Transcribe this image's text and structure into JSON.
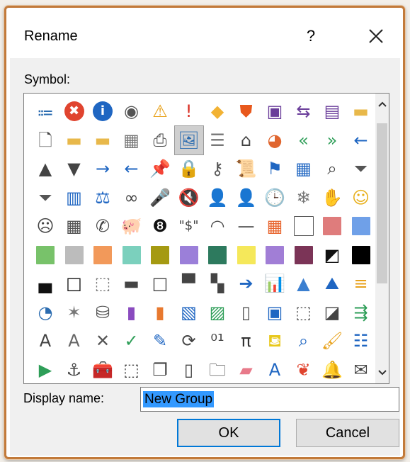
{
  "dialog": {
    "title": "Rename",
    "help_label": "?",
    "symbol_label": "Symbol:",
    "display_name_label": "Display name:",
    "display_name_value": "New Group",
    "ok_label": "OK",
    "cancel_label": "Cancel"
  },
  "symbols": [
    [
      {
        "icon": "org-chart-icon",
        "glyph": "⩴",
        "color": "#2b6cb0"
      },
      {
        "icon": "error-icon",
        "glyph": "✖",
        "color": "#e0442f"
      },
      {
        "icon": "info-icon",
        "glyph": "i",
        "color": "#1f66c2"
      },
      {
        "icon": "stop-record-icon",
        "glyph": "◉",
        "color": "#555555"
      },
      {
        "icon": "warning-triangle-icon",
        "glyph": "⚠",
        "color": "#e8a21c"
      },
      {
        "icon": "exclamation-icon",
        "glyph": "!",
        "color": "#d93025"
      },
      {
        "icon": "warning-diamond-icon",
        "glyph": "◆",
        "color": "#f2b233"
      },
      {
        "icon": "shield-icon",
        "glyph": "⛊",
        "color": "#e8581c"
      },
      {
        "icon": "save-icon",
        "glyph": "▣",
        "color": "#6a3d9a"
      },
      {
        "icon": "secure-share-icon",
        "glyph": "⇆",
        "color": "#6a3d9a"
      },
      {
        "icon": "save-all-icon",
        "glyph": "▤",
        "color": "#6a3d9a"
      },
      {
        "icon": "folder-icon",
        "glyph": "▬",
        "color": "#e8b84a"
      }
    ],
    [
      {
        "icon": "document-icon",
        "glyph": "🗋",
        "color": "#444444"
      },
      {
        "icon": "folder-green-icon",
        "glyph": "▬",
        "color": "#e8b84a"
      },
      {
        "icon": "folders-icon",
        "glyph": "▬",
        "color": "#e8b84a"
      },
      {
        "icon": "table-view-icon",
        "glyph": "▦",
        "color": "#777777"
      },
      {
        "icon": "printer-icon",
        "glyph": "⎙",
        "color": "#444444"
      },
      {
        "icon": "picture-icon",
        "glyph": "🖼",
        "color": "#2b6cb0"
      },
      {
        "icon": "document-list-icon",
        "glyph": "☰",
        "color": "#777777"
      },
      {
        "icon": "home-icon",
        "glyph": "⌂",
        "color": "#444444"
      },
      {
        "icon": "pie-chart-icon",
        "glyph": "◕",
        "color": "#e0662f"
      },
      {
        "icon": "double-left-arrow-icon",
        "glyph": "«",
        "color": "#2e9e58"
      },
      {
        "icon": "double-right-arrow-icon",
        "glyph": "»",
        "color": "#2e9e58"
      },
      {
        "icon": "left-arrow-icon",
        "glyph": "←",
        "color": "#1f66c2"
      }
    ],
    [
      {
        "icon": "triangle-up-icon",
        "glyph": "▲",
        "color": "#444444"
      },
      {
        "icon": "triangle-down-icon",
        "glyph": "▼",
        "color": "#444444"
      },
      {
        "icon": "right-arrow-icon",
        "glyph": "→",
        "color": "#1f66c2"
      },
      {
        "icon": "back-circle-icon",
        "glyph": "←",
        "color": "#1f66c2"
      },
      {
        "icon": "pin-icon",
        "glyph": "📌",
        "color": "#444444"
      },
      {
        "icon": "lock-icon",
        "glyph": "🔒",
        "color": "#e8a21c"
      },
      {
        "icon": "key-icon",
        "glyph": "⚷",
        "color": "#555555"
      },
      {
        "icon": "scroll-icon",
        "glyph": "📜",
        "color": "#444444"
      },
      {
        "icon": "flag-icon",
        "glyph": "⚑",
        "color": "#1f66c2"
      },
      {
        "icon": "calendar-table-icon",
        "glyph": "▦",
        "color": "#1f66c2"
      },
      {
        "icon": "search-icon",
        "glyph": "⌕",
        "color": "#444444"
      },
      {
        "icon": "filter-icon",
        "glyph": "⏷",
        "color": "#555555"
      }
    ],
    [
      {
        "icon": "filter-dark-icon",
        "glyph": "⏷",
        "color": "#555555"
      },
      {
        "icon": "book-icon",
        "glyph": "▥",
        "color": "#1f66c2"
      },
      {
        "icon": "scales-icon",
        "glyph": "⚖",
        "color": "#1f66c2"
      },
      {
        "icon": "rings-icon",
        "glyph": "∞",
        "color": "#444444"
      },
      {
        "icon": "microphone-icon",
        "glyph": "🎤",
        "color": "#1f66c2"
      },
      {
        "icon": "mute-speaker-icon",
        "glyph": "🔇",
        "color": "#444444"
      },
      {
        "icon": "person-tie-icon",
        "glyph": "👤",
        "color": "#7a4a2a"
      },
      {
        "icon": "person-icon",
        "glyph": "👤",
        "color": "#555555"
      },
      {
        "icon": "clock-icon",
        "glyph": "🕒",
        "color": "#1f66c2"
      },
      {
        "icon": "snowflake-icon",
        "glyph": "❄",
        "color": "#777777"
      },
      {
        "icon": "hand-icon",
        "glyph": "✋",
        "color": "#444444"
      },
      {
        "icon": "smiley-icon",
        "glyph": "☺",
        "color": "#e8b01c"
      }
    ],
    [
      {
        "icon": "sad-face-icon",
        "glyph": "☹",
        "color": "#444444"
      },
      {
        "icon": "calculator-icon",
        "glyph": "▦",
        "color": "#555555"
      },
      {
        "icon": "phone-icon",
        "glyph": "✆",
        "color": "#444444"
      },
      {
        "icon": "piggy-bank-icon",
        "glyph": "🐖",
        "color": "#444444"
      },
      {
        "icon": "eight-ball-icon",
        "glyph": "❽",
        "color": "#111111"
      },
      {
        "icon": "dollar-quote-icon",
        "glyph": "\"$\"",
        "color": "#444444"
      },
      {
        "icon": "eye-arc-icon",
        "glyph": "◠",
        "color": "#444444"
      },
      {
        "icon": "dash-line-icon",
        "glyph": "—",
        "color": "#444444"
      },
      {
        "icon": "color-grid-icon",
        "glyph": "▦",
        "color": "#e8662f"
      },
      {
        "icon": "white-square-icon",
        "glyph": "sq",
        "color": "#ffffff"
      },
      {
        "icon": "rose-square-icon",
        "glyph": "sq",
        "color": "#df7c7c"
      },
      {
        "icon": "blue-square-icon",
        "glyph": "sq",
        "color": "#6fa0e8"
      }
    ],
    [
      {
        "icon": "green-square-icon",
        "glyph": "sq",
        "color": "#78c26a"
      },
      {
        "icon": "gray-square-icon",
        "glyph": "sq",
        "color": "#bcbcbc"
      },
      {
        "icon": "orange-square-icon",
        "glyph": "sq",
        "color": "#f2995a"
      },
      {
        "icon": "teal-square-icon",
        "glyph": "sq",
        "color": "#7bd0bd"
      },
      {
        "icon": "olive-square-icon",
        "glyph": "sq",
        "color": "#a59a12"
      },
      {
        "icon": "lavender-square-icon",
        "glyph": "sq",
        "color": "#9b7fd9"
      },
      {
        "icon": "dark-green-square-icon",
        "glyph": "sq",
        "color": "#2d7a5e"
      },
      {
        "icon": "yellow-square-icon",
        "glyph": "sq",
        "color": "#f5e85a"
      },
      {
        "icon": "purple-square-icon",
        "glyph": "sq",
        "color": "#a17ed6"
      },
      {
        "icon": "maroon-square-icon",
        "glyph": "sq",
        "color": "#7b3457"
      },
      {
        "icon": "half-black-square-icon",
        "glyph": "◩",
        "color": "#111111"
      },
      {
        "icon": "black-square-icon",
        "glyph": "sq",
        "color": "#000000"
      }
    ],
    [
      {
        "icon": "border-bottom-icon",
        "glyph": "▄",
        "color": "#111111"
      },
      {
        "icon": "outline-square-icon",
        "glyph": "□",
        "color": "#111111"
      },
      {
        "icon": "dotted-square-icon",
        "glyph": "⬚",
        "color": "#777777"
      },
      {
        "icon": "border-middle-icon",
        "glyph": "▬",
        "color": "#444444"
      },
      {
        "icon": "thin-square-icon",
        "glyph": "□",
        "color": "#444444"
      },
      {
        "icon": "border-top-icon",
        "glyph": "▀",
        "color": "#444444"
      },
      {
        "icon": "checker-icon",
        "glyph": "▚",
        "color": "#444444"
      },
      {
        "icon": "forward-circle-icon",
        "glyph": "➔",
        "color": "#1f66c2"
      },
      {
        "icon": "bar-chart-icon",
        "glyph": "📊",
        "color": "#1f66c2"
      },
      {
        "icon": "cone-icon",
        "glyph": "▲",
        "color": "#3b7fd0"
      },
      {
        "icon": "mountain-chart-icon",
        "glyph": "⛰",
        "color": "#1f66c2"
      },
      {
        "icon": "horizontal-bars-icon",
        "glyph": "≡",
        "color": "#e8a21c"
      }
    ],
    [
      {
        "icon": "pie-slice-icon",
        "glyph": "◔",
        "color": "#2b6cb0"
      },
      {
        "icon": "radar-icon",
        "glyph": "✶",
        "color": "#777777"
      },
      {
        "icon": "cylinders-icon",
        "glyph": "⛁",
        "color": "#555555"
      },
      {
        "icon": "purple-book-icon",
        "glyph": "▮",
        "color": "#8a4bbf"
      },
      {
        "icon": "orange-book-icon",
        "glyph": "▮",
        "color": "#e8792f"
      },
      {
        "icon": "photo-gallery-icon",
        "glyph": "▧",
        "color": "#1f66c2"
      },
      {
        "icon": "landscape-icon",
        "glyph": "▨",
        "color": "#2e9e58"
      },
      {
        "icon": "scroll-page-icon",
        "glyph": "▯",
        "color": "#555555"
      },
      {
        "icon": "contact-card-icon",
        "glyph": "▣",
        "color": "#1f66c2"
      },
      {
        "icon": "crop-grid-icon",
        "glyph": "⬚",
        "color": "#555555"
      },
      {
        "icon": "triangle-square-icon",
        "glyph": "◪",
        "color": "#444444"
      },
      {
        "icon": "flow-arrows-icon",
        "glyph": "⇶",
        "color": "#2e9e58"
      }
    ],
    [
      {
        "icon": "text-a-box-icon",
        "glyph": "A",
        "color": "#444444"
      },
      {
        "icon": "text-a-filled-icon",
        "glyph": "A",
        "color": "#666666"
      },
      {
        "icon": "cross-icon",
        "glyph": "✕",
        "color": "#555555"
      },
      {
        "icon": "checkmark-icon",
        "glyph": "✓",
        "color": "#2e9e58"
      },
      {
        "icon": "ruler-pencil-icon",
        "glyph": "✎",
        "color": "#1f66c2"
      },
      {
        "icon": "refresh-icon",
        "glyph": "⟳",
        "color": "#444444"
      },
      {
        "icon": "binary-icon",
        "glyph": "⁰¹",
        "color": "#444444"
      },
      {
        "icon": "pi-icon",
        "glyph": "π",
        "color": "#333333"
      },
      {
        "icon": "paint-bucket-icon",
        "glyph": "⛾",
        "color": "#e8c81c"
      },
      {
        "icon": "zoom-icon",
        "glyph": "⌕",
        "color": "#1f66c2"
      },
      {
        "icon": "paint-brush-icon",
        "glyph": "🖌",
        "color": "#e8a21c"
      },
      {
        "icon": "bulleted-list-icon",
        "glyph": "☷",
        "color": "#1f66c2"
      }
    ],
    [
      {
        "icon": "play-icon",
        "glyph": "▶",
        "color": "#2e9e58"
      },
      {
        "icon": "anchor-icon",
        "glyph": "⚓",
        "color": "#444444"
      },
      {
        "icon": "toolbox-icon",
        "glyph": "🧰",
        "color": "#444444"
      },
      {
        "icon": "lasso-add-icon",
        "glyph": "⬚",
        "color": "#444444"
      },
      {
        "icon": "copy-icon",
        "glyph": "❐",
        "color": "#444444"
      },
      {
        "icon": "tablet-icon",
        "glyph": "▯",
        "color": "#444444"
      },
      {
        "icon": "open-folder-icon",
        "glyph": "🗀",
        "color": "#444444"
      },
      {
        "icon": "eraser-icon",
        "glyph": "▰",
        "color": "#e87a8a"
      },
      {
        "icon": "italic-a-icon",
        "glyph": "A",
        "color": "#1f66c2"
      },
      {
        "icon": "butterfly-icon",
        "glyph": "❦",
        "color": "#e0442f"
      },
      {
        "icon": "bell-icon",
        "glyph": "🔔",
        "color": "#e8b01c"
      },
      {
        "icon": "envelope-open-icon",
        "glyph": "✉",
        "color": "#444444"
      }
    ]
  ],
  "selected_symbol": "picture-icon"
}
